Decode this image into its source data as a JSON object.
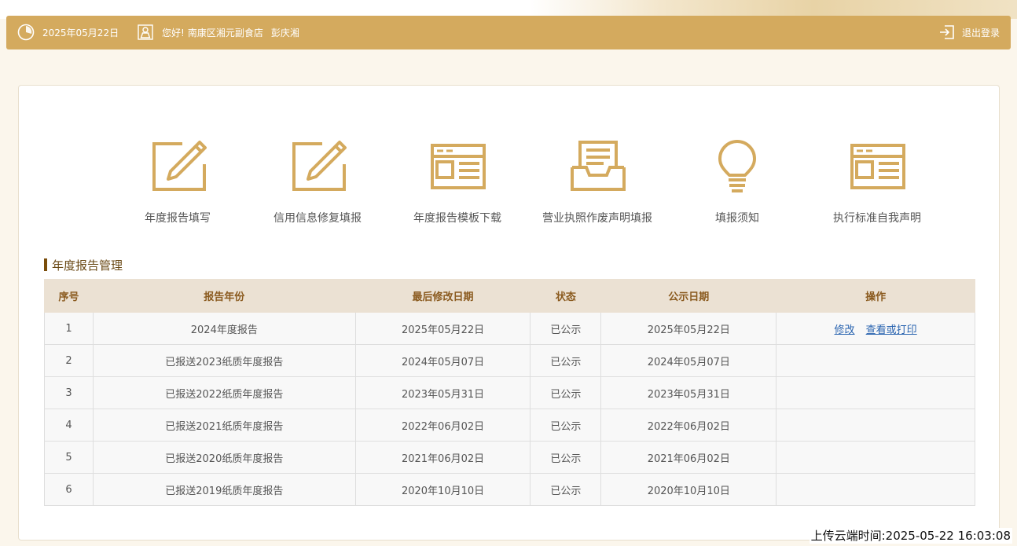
{
  "header": {
    "date": "2025年05月22日",
    "greeting": "您好!",
    "company": "南康区湘元副食店",
    "person": "彭庆湘",
    "logout_label": "退出登录"
  },
  "tools": [
    {
      "label": "年度报告填写",
      "icon": "edit-icon"
    },
    {
      "label": "信用信息修复填报",
      "icon": "edit-icon"
    },
    {
      "label": "年度报告模板下载",
      "icon": "template-icon"
    },
    {
      "label": "营业执照作废声明填报",
      "icon": "inbox-icon"
    },
    {
      "label": "填报须知",
      "icon": "lightbulb-icon"
    },
    {
      "label": "执行标准自我声明",
      "icon": "template-icon"
    }
  ],
  "section": {
    "title": "年度报告管理"
  },
  "table": {
    "headers": [
      "序号",
      "报告年份",
      "最后修改日期",
      "状态",
      "公示日期",
      "操作"
    ],
    "rows": [
      [
        "1",
        "2024年度报告",
        "2025年05月22日",
        "已公示",
        "2025年05月22日"
      ],
      [
        "2",
        "已报送2023纸质年度报告",
        "2024年05月07日",
        "已公示",
        "2024年05月07日"
      ],
      [
        "3",
        "已报送2022纸质年度报告",
        "2023年05月31日",
        "已公示",
        "2023年05月31日"
      ],
      [
        "4",
        "已报送2021纸质年度报告",
        "2022年06月02日",
        "已公示",
        "2022年06月02日"
      ],
      [
        "5",
        "已报送2020纸质年度报告",
        "2021年06月02日",
        "已公示",
        "2021年06月02日"
      ],
      [
        "6",
        "已报送2019纸质年度报告",
        "2020年10月10日",
        "已公示",
        "2020年10月10日"
      ]
    ],
    "actions": {
      "edit": "修改",
      "view": "查看或打印"
    }
  },
  "footer": {
    "upload_time": "上传云端时间:2025-05-22 16:03:08"
  },
  "colors": {
    "accent": "#d4aa5e",
    "header_text": "#8a5a1e",
    "link": "#2a64b0"
  }
}
